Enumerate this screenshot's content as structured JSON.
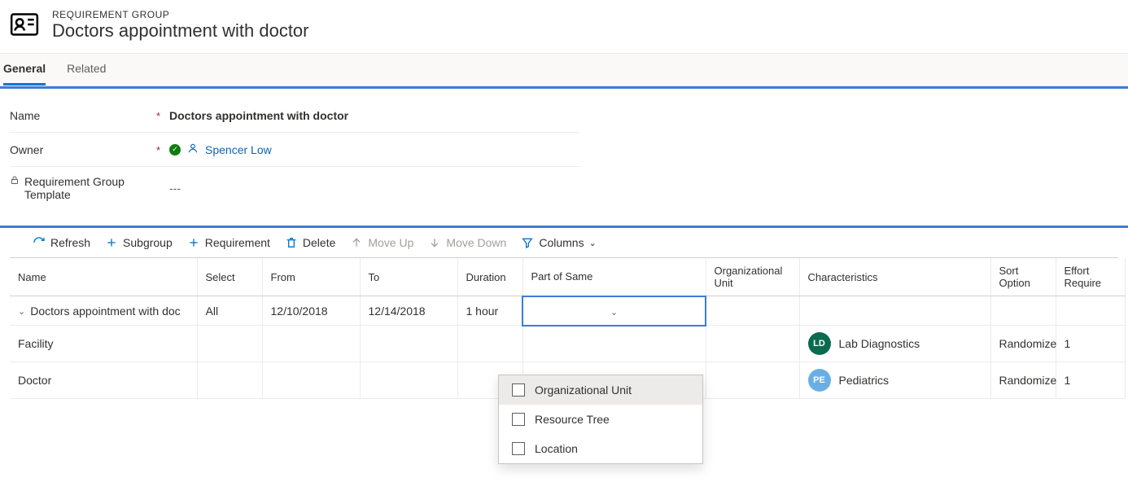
{
  "header": {
    "supertitle": "REQUIREMENT GROUP",
    "title": "Doctors appointment with doctor"
  },
  "tabs": {
    "general": "General",
    "related": "Related"
  },
  "form": {
    "name_label": "Name",
    "name_value": "Doctors appointment with doctor",
    "owner_label": "Owner",
    "owner_value": "Spencer Low",
    "template_label": "Requirement Group Template",
    "template_value": "---"
  },
  "toolbar": {
    "refresh": "Refresh",
    "subgroup": "Subgroup",
    "requirement": "Requirement",
    "delete": "Delete",
    "move_up": "Move Up",
    "move_down": "Move Down",
    "columns": "Columns"
  },
  "grid": {
    "headers": {
      "name": "Name",
      "select": "Select",
      "from": "From",
      "to": "To",
      "duration": "Duration",
      "part_of_same": "Part of Same",
      "org_unit": "Organizational Unit",
      "characteristics": "Characteristics",
      "sort_option": "Sort Option",
      "effort": "Effort Require"
    },
    "rows": {
      "r0": {
        "name": "Doctors appointment with doc",
        "select": "All",
        "from": "12/10/2018",
        "to": "12/14/2018",
        "duration": "1 hour"
      },
      "r1": {
        "name": "Facility",
        "char_initials": "LD",
        "char_label": "Lab Diagnostics",
        "sort": "Randomize",
        "effort": "1"
      },
      "r2": {
        "name": "Doctor",
        "char_initials": "PE",
        "char_label": "Pediatrics",
        "sort": "Randomize",
        "effort": "1"
      }
    }
  },
  "dropdown": {
    "opt0": "Organizational Unit",
    "opt1": "Resource Tree",
    "opt2": "Location"
  }
}
